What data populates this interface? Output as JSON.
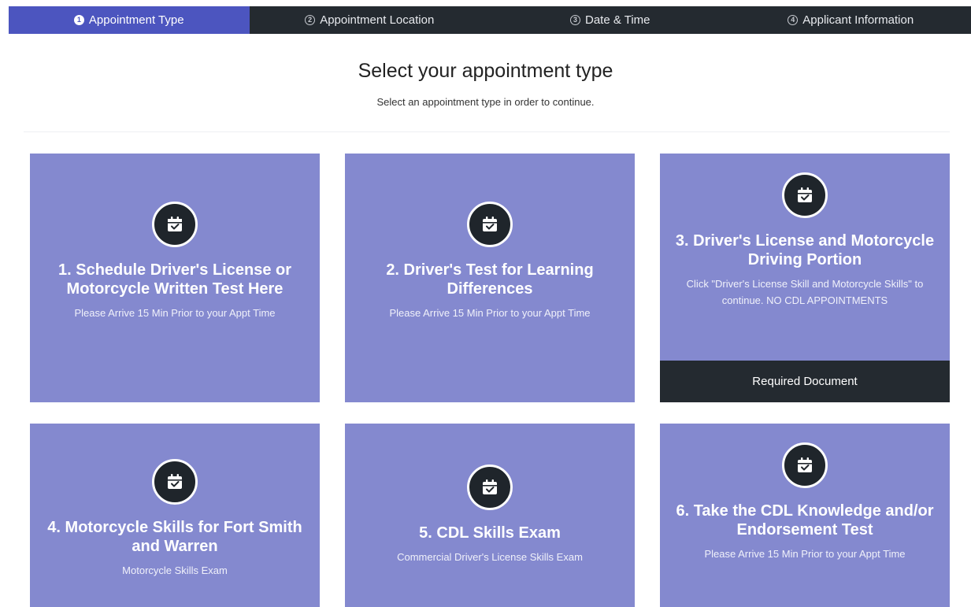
{
  "stepper": {
    "steps": [
      {
        "num": "1",
        "label": "Appointment Type",
        "active": true
      },
      {
        "num": "2",
        "label": "Appointment Location",
        "active": false
      },
      {
        "num": "3",
        "label": "Date & Time",
        "active": false
      },
      {
        "num": "4",
        "label": "Applicant Information",
        "active": false
      }
    ]
  },
  "main": {
    "title": "Select your appointment type",
    "subtitle": "Select an appointment type in order to continue."
  },
  "cards": [
    {
      "title": "1. Schedule Driver's License or Motorcycle Written Test Here",
      "desc": "Please Arrive 15 Min Prior to your Appt Time",
      "icon": "calendar-check-icon"
    },
    {
      "title": "2. Driver's Test for Learning Differences",
      "desc": "Please Arrive 15 Min Prior to your Appt Time",
      "icon": "calendar-check-icon"
    },
    {
      "title": "3. Driver's License and Motorcycle Driving Portion",
      "desc": "Click \"Driver's License Skill and Motorcycle Skills\" to continue. NO CDL APPOINTMENTS",
      "icon": "calendar-check-icon",
      "button": "Required Document"
    },
    {
      "title": "4. Motorcycle Skills for Fort Smith and Warren",
      "desc": "Motorcycle Skills Exam",
      "icon": "calendar-check-icon"
    },
    {
      "title": "5. CDL Skills Exam",
      "desc": "Commercial Driver's License Skills Exam",
      "icon": "calendar-check-icon"
    },
    {
      "title": "6. Take the CDL Knowledge and/or Endorsement Test",
      "desc": "Please Arrive 15 Min Prior to your Appt Time",
      "icon": "calendar-check-icon"
    }
  ],
  "colors": {
    "accent": "#4c55bf",
    "card_bg": "#8489cf",
    "dark": "#242a30"
  }
}
